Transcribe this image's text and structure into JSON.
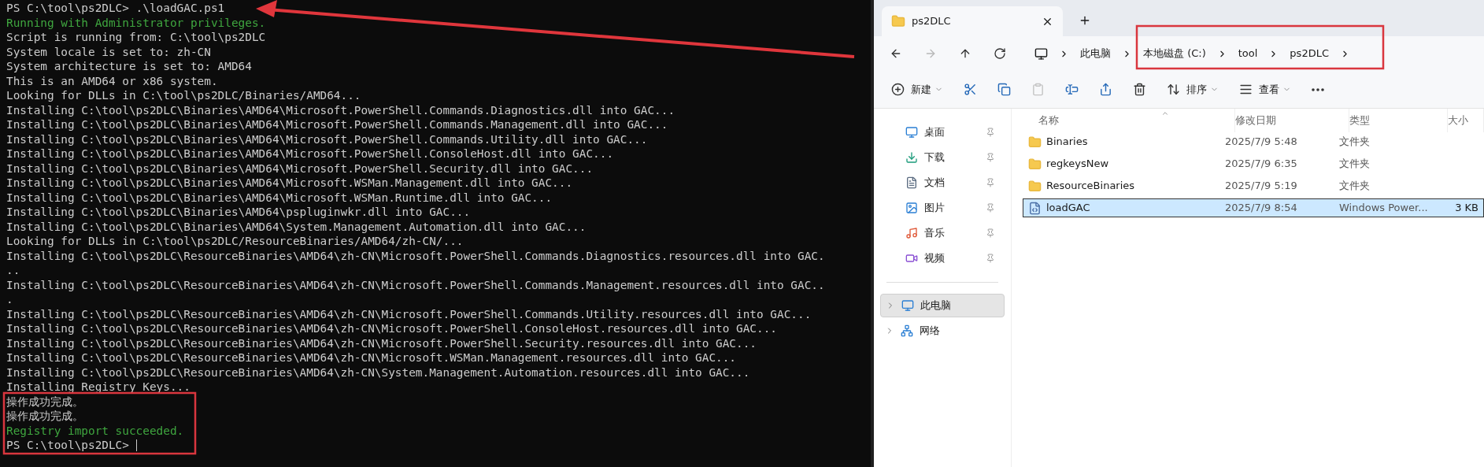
{
  "terminal": {
    "cursor": true,
    "lines": [
      {
        "kind": "normal",
        "text": "PS C:\\tool\\ps2DLC> .\\loadGAC.ps1"
      },
      {
        "kind": "success",
        "text": "Running with Administrator privileges."
      },
      {
        "kind": "normal",
        "text": "Script is running from: C:\\tool\\ps2DLC"
      },
      {
        "kind": "normal",
        "text": "System locale is set to: zh-CN"
      },
      {
        "kind": "normal",
        "text": "System architecture is set to: AMD64"
      },
      {
        "kind": "normal",
        "text": "This is an AMD64 or x86 system."
      },
      {
        "kind": "normal",
        "text": "Looking for DLLs in C:\\tool\\ps2DLC/Binaries/AMD64..."
      },
      {
        "kind": "normal",
        "text": "Installing C:\\tool\\ps2DLC\\Binaries\\AMD64\\Microsoft.PowerShell.Commands.Diagnostics.dll into GAC..."
      },
      {
        "kind": "normal",
        "text": "Installing C:\\tool\\ps2DLC\\Binaries\\AMD64\\Microsoft.PowerShell.Commands.Management.dll into GAC..."
      },
      {
        "kind": "normal",
        "text": "Installing C:\\tool\\ps2DLC\\Binaries\\AMD64\\Microsoft.PowerShell.Commands.Utility.dll into GAC..."
      },
      {
        "kind": "normal",
        "text": "Installing C:\\tool\\ps2DLC\\Binaries\\AMD64\\Microsoft.PowerShell.ConsoleHost.dll into GAC..."
      },
      {
        "kind": "normal",
        "text": "Installing C:\\tool\\ps2DLC\\Binaries\\AMD64\\Microsoft.PowerShell.Security.dll into GAC..."
      },
      {
        "kind": "normal",
        "text": "Installing C:\\tool\\ps2DLC\\Binaries\\AMD64\\Microsoft.WSMan.Management.dll into GAC..."
      },
      {
        "kind": "normal",
        "text": "Installing C:\\tool\\ps2DLC\\Binaries\\AMD64\\Microsoft.WSMan.Runtime.dll into GAC..."
      },
      {
        "kind": "normal",
        "text": "Installing C:\\tool\\ps2DLC\\Binaries\\AMD64\\pspluginwkr.dll into GAC..."
      },
      {
        "kind": "normal",
        "text": "Installing C:\\tool\\ps2DLC\\Binaries\\AMD64\\System.Management.Automation.dll into GAC..."
      },
      {
        "kind": "normal",
        "text": "Looking for DLLs in C:\\tool\\ps2DLC/ResourceBinaries/AMD64/zh-CN/..."
      },
      {
        "kind": "normal",
        "text": "Installing C:\\tool\\ps2DLC\\ResourceBinaries\\AMD64\\zh-CN\\Microsoft.PowerShell.Commands.Diagnostics.resources.dll into GAC."
      },
      {
        "kind": "normal",
        "text": ".."
      },
      {
        "kind": "normal",
        "text": "Installing C:\\tool\\ps2DLC\\ResourceBinaries\\AMD64\\zh-CN\\Microsoft.PowerShell.Commands.Management.resources.dll into GAC.."
      },
      {
        "kind": "normal",
        "text": "."
      },
      {
        "kind": "normal",
        "text": "Installing C:\\tool\\ps2DLC\\ResourceBinaries\\AMD64\\zh-CN\\Microsoft.PowerShell.Commands.Utility.resources.dll into GAC..."
      },
      {
        "kind": "normal",
        "text": "Installing C:\\tool\\ps2DLC\\ResourceBinaries\\AMD64\\zh-CN\\Microsoft.PowerShell.ConsoleHost.resources.dll into GAC..."
      },
      {
        "kind": "normal",
        "text": "Installing C:\\tool\\ps2DLC\\ResourceBinaries\\AMD64\\zh-CN\\Microsoft.PowerShell.Security.resources.dll into GAC..."
      },
      {
        "kind": "normal",
        "text": "Installing C:\\tool\\ps2DLC\\ResourceBinaries\\AMD64\\zh-CN\\Microsoft.WSMan.Management.resources.dll into GAC..."
      },
      {
        "kind": "normal",
        "text": "Installing C:\\tool\\ps2DLC\\ResourceBinaries\\AMD64\\zh-CN\\System.Management.Automation.resources.dll into GAC..."
      },
      {
        "kind": "normal",
        "text": "Installing Registry Keys..."
      },
      {
        "kind": "normal",
        "text": "操作成功完成。"
      },
      {
        "kind": "normal",
        "text": "操作成功完成。"
      },
      {
        "kind": "success",
        "text": "Registry import succeeded."
      },
      {
        "kind": "normal",
        "text": "PS C:\\tool\\ps2DLC>"
      }
    ]
  },
  "explorer": {
    "tab": {
      "title": "ps2DLC",
      "selected": true
    },
    "nav": [
      {
        "kind": "back",
        "disabled": false
      },
      {
        "kind": "forward",
        "disabled": true
      },
      {
        "kind": "up",
        "disabled": false
      },
      {
        "kind": "refresh",
        "disabled": false
      }
    ],
    "breadcrumb": [
      "此电脑",
      "本地磁盘 (C:)",
      "tool",
      "ps2DLC"
    ],
    "toolbar": [
      {
        "kind": "new",
        "label": "新建",
        "disabled": false
      },
      {
        "kind": "cut",
        "disabled": false
      },
      {
        "kind": "copy",
        "disabled": false
      },
      {
        "kind": "paste",
        "disabled": true
      },
      {
        "kind": "rename",
        "disabled": false
      },
      {
        "kind": "share",
        "disabled": false
      },
      {
        "kind": "delete",
        "disabled": false
      },
      {
        "kind": "sort",
        "label": "排序",
        "disabled": false
      },
      {
        "kind": "view",
        "label": "查看",
        "disabled": false
      },
      {
        "kind": "more",
        "disabled": false
      }
    ],
    "quick_access": [
      {
        "kind": "desktop",
        "label": "桌面"
      },
      {
        "kind": "downloads",
        "label": "下载"
      },
      {
        "kind": "documents",
        "label": "文档"
      },
      {
        "kind": "pictures",
        "label": "图片"
      },
      {
        "kind": "music",
        "label": "音乐"
      },
      {
        "kind": "videos",
        "label": "视频"
      }
    ],
    "tree": [
      {
        "kind": "pc",
        "label": "此电脑",
        "selected": true
      },
      {
        "kind": "network",
        "label": "网络",
        "selected": false
      }
    ],
    "columns": [
      "名称",
      "修改日期",
      "类型",
      "大小"
    ],
    "files": [
      {
        "kind": "folder",
        "name": "Binaries",
        "modified": "2025/7/9 5:48",
        "type": "文件夹",
        "selected": false
      },
      {
        "kind": "folder",
        "name": "regkeysNew",
        "modified": "2025/7/9 6:35",
        "type": "文件夹",
        "selected": false
      },
      {
        "kind": "folder",
        "name": "ResourceBinaries",
        "modified": "2025/7/9 5:19",
        "type": "文件夹",
        "selected": false
      },
      {
        "kind": "script",
        "name": "loadGAC",
        "modified": "2025/7/9 8:54",
        "type": "Windows Power...",
        "size": "3 KB",
        "selected": true
      }
    ]
  }
}
